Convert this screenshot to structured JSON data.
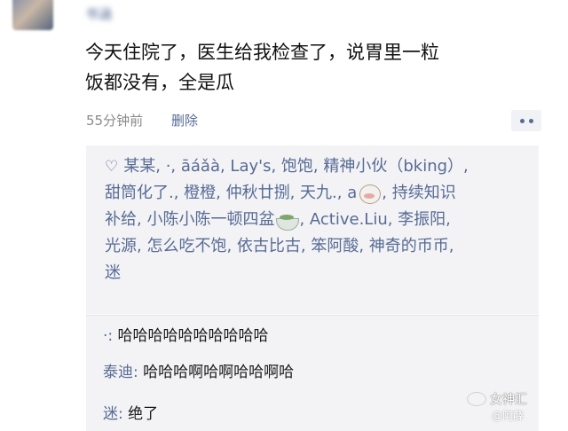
{
  "post": {
    "username": "书涵",
    "text_line1": "今天住院了，医生给我检查了，说胃里一粒",
    "text_line2": "饭都没有，全是瓜",
    "time": "55分钟前",
    "delete_label": "删除"
  },
  "likes": {
    "line1": "某某, ·, āáǎà, Lay's, 饱饱, 精神小伙（bking）,",
    "line2a": "甜筒化了., 橙橙, 仲秋廿捌, 天九., a",
    "line2b": ", 持续知识",
    "line3a": "补给, 小陈小陈一顿四盆",
    "line3b": ", Active.Liu, 李振阳,",
    "line4": "光源, 怎么吃不饱, 依古比古, 笨阿酸, 神奇的币币,",
    "line5": "迷",
    "heart_icon": "♡",
    "emoji_1": "cow-face-icon",
    "emoji_2": "bowl-icon"
  },
  "comments": [
    {
      "author": "·:",
      "text": " 哈哈哈哈哈哈哈哈哈哈"
    },
    {
      "author": "泰迪:",
      "text": " 哈哈哈啊哈啊哈哈啊哈"
    },
    {
      "author": "迷:",
      "text": " 绝了"
    }
  ],
  "watermark": {
    "title": "女神汇",
    "sub": "@阿薛",
    "icon": "weibo-logo-icon"
  },
  "colors": {
    "link": "#576b95",
    "panel": "#f3f3f5",
    "meta": "#8a8a8a"
  }
}
